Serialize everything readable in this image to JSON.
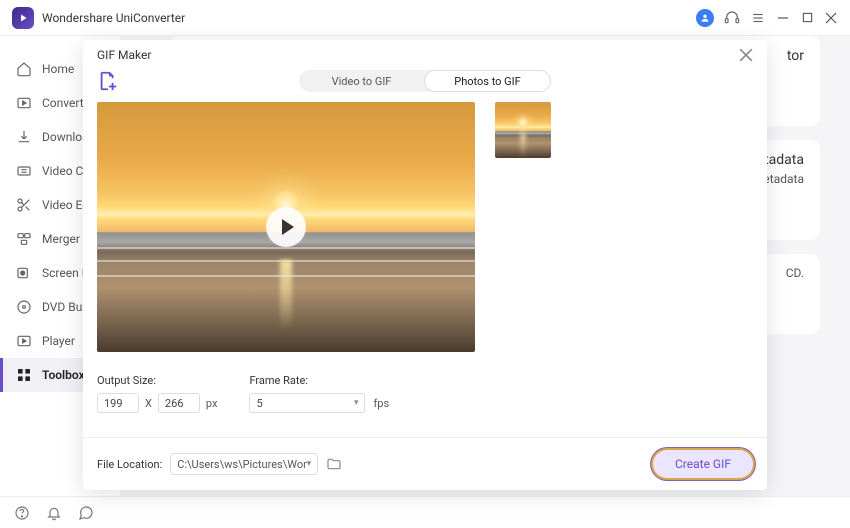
{
  "title": "Wondershare UniConverter",
  "sidebar": {
    "items": [
      {
        "label": "Home"
      },
      {
        "label": "Converter"
      },
      {
        "label": "Downloader"
      },
      {
        "label": "Video Compressor"
      },
      {
        "label": "Video Editor"
      },
      {
        "label": "Merger"
      },
      {
        "label": "Screen Recorder"
      },
      {
        "label": "DVD Burner"
      },
      {
        "label": "Player"
      },
      {
        "label": "Toolbox"
      }
    ]
  },
  "bg": {
    "card1_suffix": "tor",
    "card2_title": "etadata",
    "card2_sub": "Metadata",
    "card3_text": "CD."
  },
  "modal": {
    "title": "GIF Maker",
    "tabs": {
      "video": "Video to GIF",
      "photos": "Photos to GIF"
    },
    "output_size_label": "Output Size:",
    "width": "199",
    "mult": "X",
    "height": "266",
    "px": "px",
    "frame_rate_label": "Frame Rate:",
    "frame_rate_value": "5",
    "fps": "fps",
    "file_location_label": "File Location:",
    "file_location_value": "C:\\Users\\ws\\Pictures\\Wonders",
    "create_label": "Create GIF"
  }
}
